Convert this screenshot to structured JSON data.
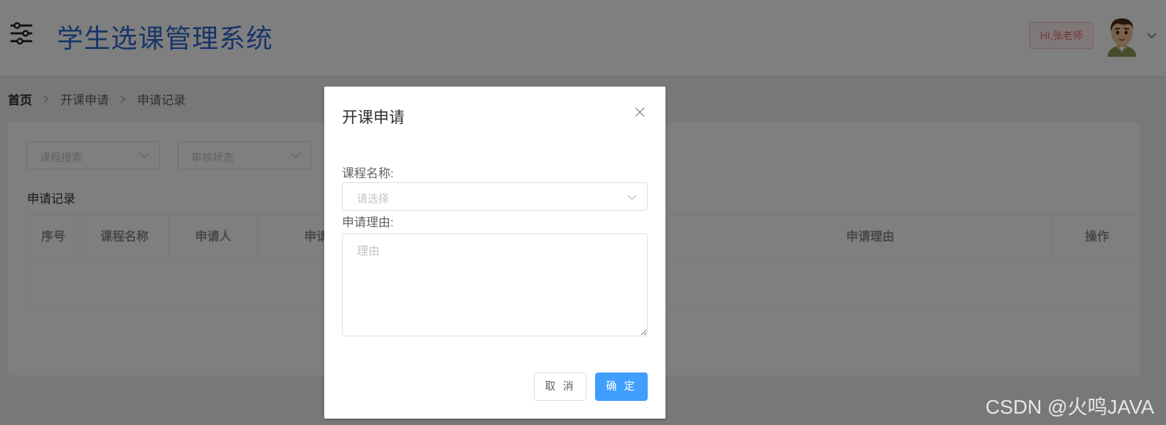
{
  "header": {
    "title": "学生选课管理系统",
    "greeting": "HI,张老师",
    "menu_icon": "sliders-icon",
    "avatar_icon": "user-avatar"
  },
  "breadcrumb": [
    "首页",
    "开课申请",
    "申请记录"
  ],
  "filters": {
    "course_search_placeholder": "课程搜索",
    "status_placeholder": "审核状态"
  },
  "records": {
    "title": "申请记录",
    "columns": [
      "序号",
      "课程名称",
      "申请人",
      "申请",
      "申请理由",
      "操作"
    ]
  },
  "dialog": {
    "title": "开课申请",
    "course_label": "课程名称:",
    "course_placeholder": "请选择",
    "reason_label": "申请理由:",
    "reason_placeholder": "理由",
    "cancel_label": "取 消",
    "confirm_label": "确 定"
  },
  "watermark": "CSDN @火鸣JAVA",
  "colors": {
    "title_blue": "#2f6ad1",
    "primary": "#409eff",
    "danger": "#f56c6c"
  }
}
